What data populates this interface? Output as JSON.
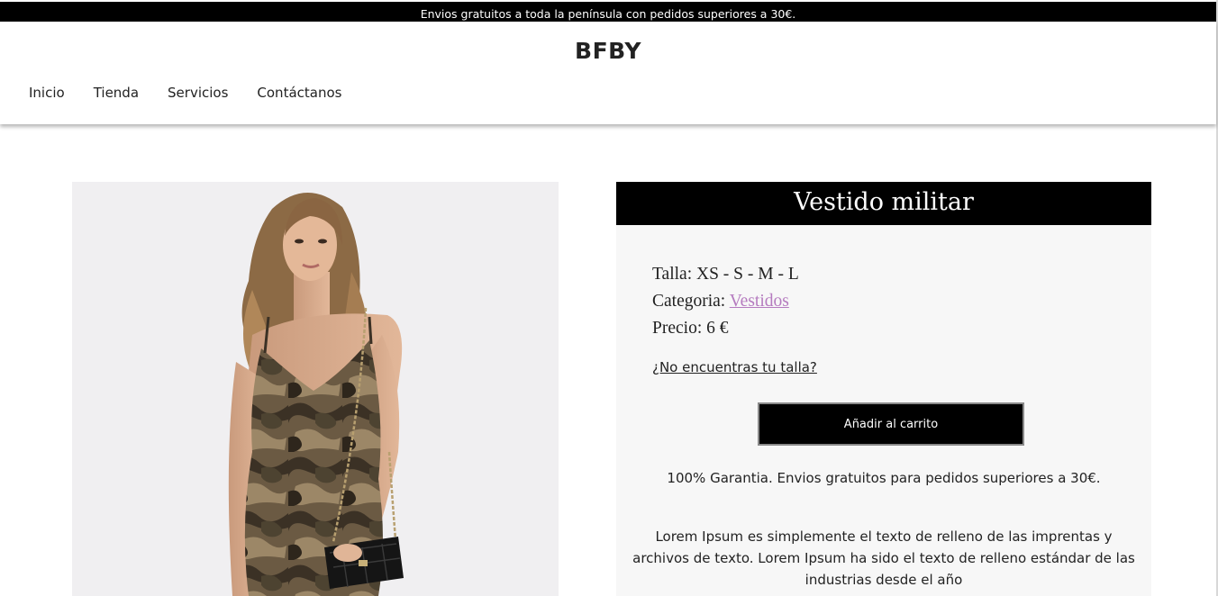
{
  "promo": {
    "text": "Envios gratuitos a toda la península con pedidos superiores a 30€."
  },
  "header": {
    "brand": "BFBY",
    "nav": [
      "Inicio",
      "Tienda",
      "Servicios",
      "Contáctanos"
    ]
  },
  "product": {
    "image_alt": "Modelo con vestido de camuflaje militar y bolso acolchado negro",
    "title": "Vestido militar",
    "size_label": "Talla:",
    "size_value": "XS - S - M - L",
    "category_label": "Categoria:",
    "category_value": "Vestidos",
    "price_label": "Precio:",
    "price_value": "6 €",
    "size_help_link": "¿No encuentras tu talla?",
    "add_to_cart": "Añadir al carrito",
    "guarantee": "100% Garantia. Envios gratuitos para pedidos superiores a 30€.",
    "description": "Lorem Ipsum es simplemente el texto de relleno de las imprentas y archivos de texto. Lorem Ipsum ha sido el texto de relleno estándar de las industrias desde el año"
  },
  "colors": {
    "promo_bg": "#000000",
    "title_bg": "#000000",
    "panel_bg": "#f7f7f7",
    "link_accent": "#b57bbf"
  }
}
